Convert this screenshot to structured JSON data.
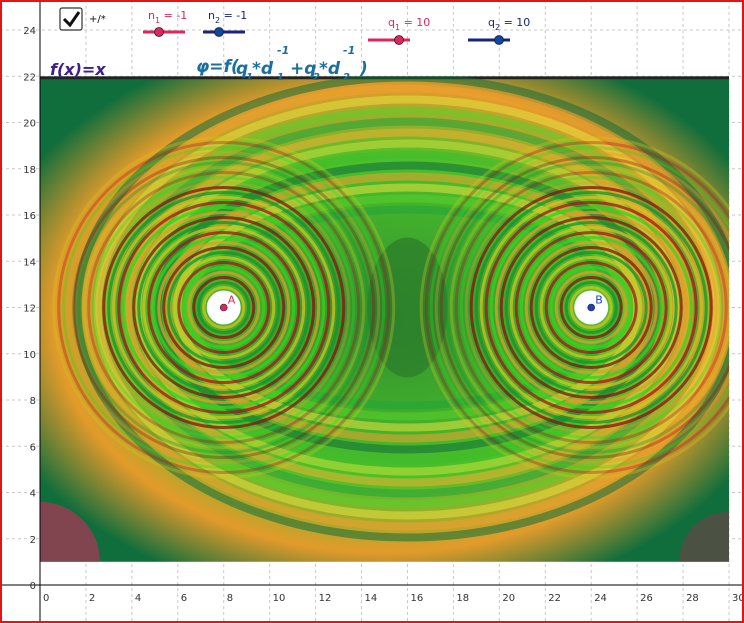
{
  "checkbox": {
    "label": "+/*",
    "checked": true
  },
  "sliders": [
    {
      "id": "n1",
      "var": "n",
      "sub": "1",
      "eq": " = -1",
      "value": -1,
      "color": "#e0245e",
      "knob": "#e0245e"
    },
    {
      "id": "n2",
      "var": "n",
      "sub": "2",
      "eq": " = -1",
      "value": -1,
      "color": "#1a237e",
      "knob": "#0d47a1"
    },
    {
      "id": "q1",
      "var": "q",
      "sub": "1",
      "eq": " = 10",
      "value": 10,
      "color": "#e0245e",
      "knob": "#e0245e"
    },
    {
      "id": "q2",
      "var": "q",
      "sub": "2",
      "eq": " = 10",
      "value": 10,
      "color": "#1a237e",
      "knob": "#0d47a1"
    }
  ],
  "function_label": "f(x)=x",
  "formula": {
    "phi": "φ=f(",
    "q1": "q",
    "q1_sub": "1",
    "star1": "*d",
    "d1_sub": "1",
    "exp1": "-1",
    "plus": "+q",
    "q2_sub": "2",
    "star2": "*d",
    "d2_sub": "2",
    "exp2": "-1",
    "close": ")"
  },
  "points": [
    {
      "label": "A",
      "x": 8,
      "y": 12,
      "color": "#e0245e"
    },
    {
      "label": "B",
      "x": 24,
      "y": 12,
      "color": "#1f3fbf"
    }
  ],
  "axes": {
    "x_ticks": [
      "0",
      "2",
      "4",
      "6",
      "8",
      "10",
      "12",
      "14",
      "16",
      "18",
      "20",
      "22",
      "24",
      "26",
      "28",
      "30"
    ],
    "y_ticks": [
      "0",
      "2",
      "4",
      "6",
      "8",
      "10",
      "12",
      "14",
      "16",
      "18",
      "20",
      "22",
      "24"
    ],
    "x_range": [
      0,
      30
    ],
    "y_range": [
      0,
      24
    ],
    "grid": true
  },
  "field_region": {
    "x_range": [
      0,
      30
    ],
    "y_range": [
      1,
      22
    ]
  }
}
